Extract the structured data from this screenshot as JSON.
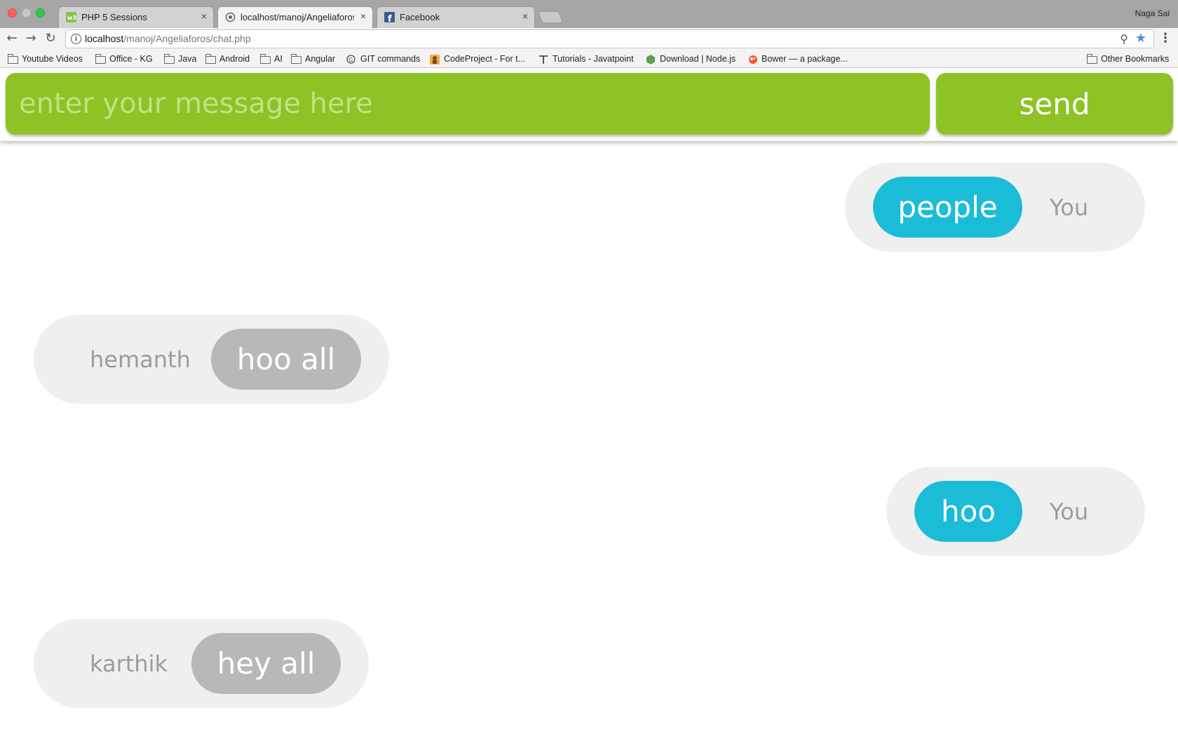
{
  "browser": {
    "tabs": [
      {
        "title": "PHP 5 Sessions",
        "icon": "w3schools-icon",
        "close": "×"
      },
      {
        "title": "localhost/manoj/Angeliaforos/c",
        "icon": "page-loading-icon",
        "close": "×"
      },
      {
        "title": "Facebook",
        "icon": "facebook-icon",
        "close": "×"
      }
    ],
    "profile_name": "Naga Sai",
    "url_host": "localhost",
    "url_path": "/manoj/Angeliaforos/chat.php",
    "bookmarks": [
      {
        "label": "Youtube Videos",
        "icon": "folder-icon"
      },
      {
        "label": "Office - KG",
        "icon": "folder-icon"
      },
      {
        "label": "Java",
        "icon": "folder-icon"
      },
      {
        "label": "Android",
        "icon": "folder-icon"
      },
      {
        "label": "AI",
        "icon": "folder-icon"
      },
      {
        "label": "Angular",
        "icon": "folder-icon"
      },
      {
        "label": "GIT commands",
        "icon": "git-icon"
      },
      {
        "label": "CodeProject - For t...",
        "icon": "codeproject-icon"
      },
      {
        "label": "Tutorials - Javatpoint",
        "icon": "javatpoint-icon"
      },
      {
        "label": "Download | Node.js",
        "icon": "nodejs-icon"
      },
      {
        "label": "Bower — a package...",
        "icon": "bower-icon"
      }
    ],
    "other_bookmarks": "Other Bookmarks"
  },
  "chat": {
    "input_placeholder": "enter your message here",
    "send_label": "send",
    "messages": [
      {
        "text": "people",
        "sender": "You",
        "mine": true
      },
      {
        "text": "hoo all",
        "sender": "hemanth",
        "mine": false
      },
      {
        "text": "hoo",
        "sender": "You",
        "mine": true
      },
      {
        "text": "hey all",
        "sender": "karthik",
        "mine": false
      }
    ]
  },
  "colors": {
    "accent_green": "#8dc324",
    "own_bubble": "#1bbcd8",
    "other_bubble": "#b8b8b8",
    "row_background": "#efefef",
    "sender_text": "#9c9c9c"
  }
}
